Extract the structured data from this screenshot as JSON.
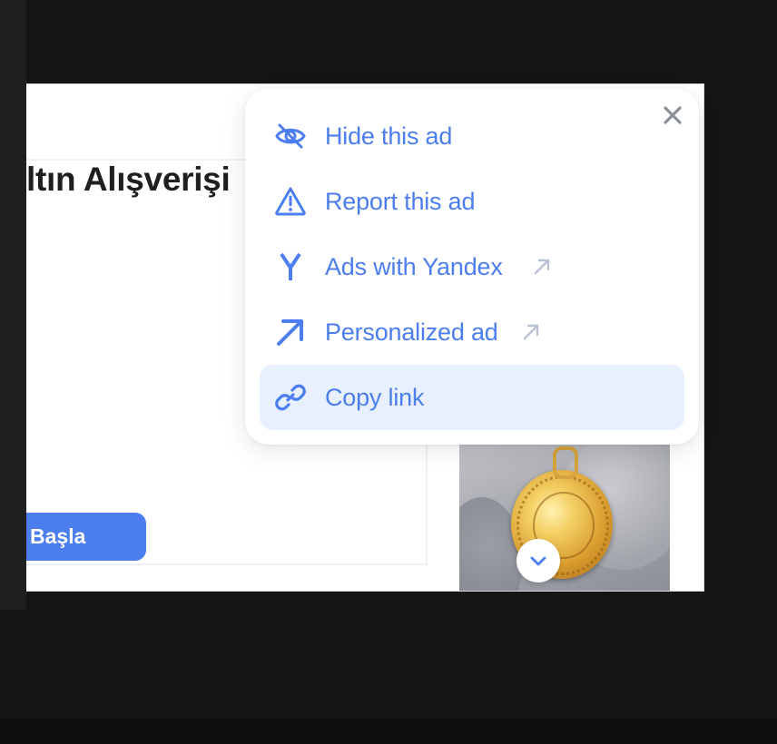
{
  "ad": {
    "title_fragment": "ltın Alışverişi",
    "cta_label": "Başla"
  },
  "menu": {
    "items": [
      {
        "label": "Hide this ad",
        "icon": "eye-off-icon",
        "external": false
      },
      {
        "label": "Report this ad",
        "icon": "warning-icon",
        "external": false
      },
      {
        "label": "Ads with Yandex",
        "icon": "yandex-logo-icon",
        "external": true
      },
      {
        "label": "Personalized ad",
        "icon": "arrow-up-right-icon",
        "external": true
      },
      {
        "label": "Copy link",
        "icon": "link-icon",
        "external": false,
        "active": true
      }
    ],
    "close_icon": "close-icon"
  },
  "colors": {
    "accent": "#4c7ef0",
    "active_bg": "#e7f0fc",
    "page_bg": "#151516"
  }
}
